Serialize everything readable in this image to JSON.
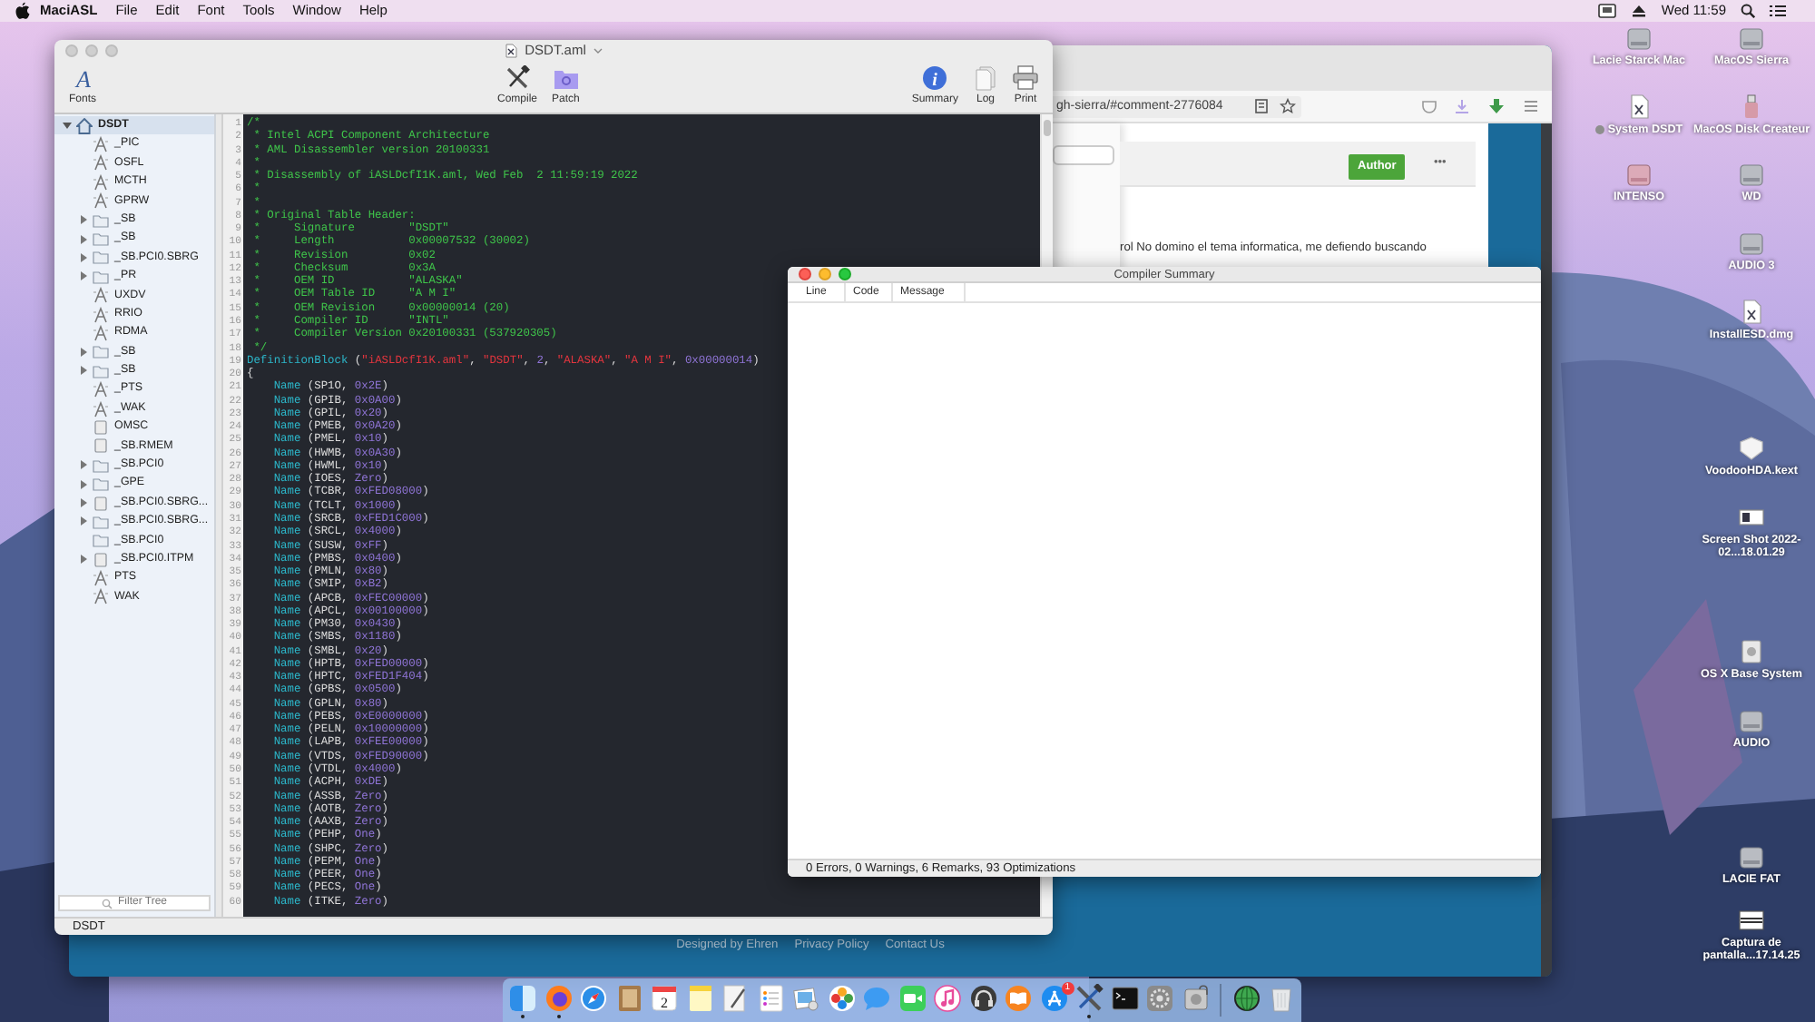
{
  "menubar": {
    "app": "MaciASL",
    "menus": [
      "File",
      "Edit",
      "Font",
      "Tools",
      "Window",
      "Help"
    ],
    "clock": "Wed 11:59"
  },
  "browser": {
    "url": "gh-sierra/#comment-2776084",
    "badge": "Author",
    "more": "•••",
    "text": "rol No domino el tema informatica, me defiendo buscando",
    "footer_links": [
      "Designed by Ehren",
      "Privacy Policy",
      "Contact Us"
    ]
  },
  "editor": {
    "title": "DSDT.aml",
    "toolbar": [
      {
        "kind": "fonts",
        "glyph": "A",
        "label": "Fonts"
      },
      {
        "kind": "compile",
        "label": "Compile"
      },
      {
        "kind": "patch",
        "label": "Patch"
      },
      {
        "kind": "summary",
        "glyph": "i",
        "label": "Summary"
      },
      {
        "kind": "log",
        "label": "Log"
      },
      {
        "kind": "print",
        "label": "Print"
      }
    ],
    "tree": {
      "label": "DSDT",
      "kind": "root",
      "expandable": true,
      "expanded": true,
      "selected": true,
      "children": [
        {
          "label": "_PIC",
          "kind": "method",
          "expandable": false,
          "expanded": false,
          "selected": false
        },
        {
          "label": "OSFL",
          "kind": "method",
          "expandable": false,
          "expanded": false,
          "selected": false
        },
        {
          "label": "MCTH",
          "kind": "method",
          "expandable": false,
          "expanded": false,
          "selected": false
        },
        {
          "label": "GPRW",
          "kind": "method",
          "expandable": false,
          "expanded": false,
          "selected": false
        },
        {
          "label": "_SB",
          "kind": "folder",
          "expandable": true,
          "expanded": false,
          "selected": false
        },
        {
          "label": "_SB",
          "kind": "folder",
          "expandable": true,
          "expanded": false,
          "selected": false
        },
        {
          "label": "_SB.PCI0.SBRG",
          "kind": "folder",
          "expandable": true,
          "expanded": false,
          "selected": false
        },
        {
          "label": "_PR",
          "kind": "folder",
          "expandable": true,
          "expanded": false,
          "selected": false
        },
        {
          "label": "UXDV",
          "kind": "method",
          "expandable": false,
          "expanded": false,
          "selected": false
        },
        {
          "label": "RRIO",
          "kind": "method",
          "expandable": false,
          "expanded": false,
          "selected": false
        },
        {
          "label": "RDMA",
          "kind": "method",
          "expandable": false,
          "expanded": false,
          "selected": false
        },
        {
          "label": "_SB",
          "kind": "folder",
          "expandable": true,
          "expanded": false,
          "selected": false
        },
        {
          "label": "_SB",
          "kind": "folder",
          "expandable": true,
          "expanded": false,
          "selected": false
        },
        {
          "label": "_PTS",
          "kind": "method",
          "expandable": false,
          "expanded": false,
          "selected": false
        },
        {
          "label": "_WAK",
          "kind": "method",
          "expandable": false,
          "expanded": false,
          "selected": false
        },
        {
          "label": "OMSC",
          "kind": "device",
          "expandable": false,
          "expanded": false,
          "selected": false
        },
        {
          "label": "_SB.RMEM",
          "kind": "device",
          "expandable": false,
          "expanded": false,
          "selected": false
        },
        {
          "label": "_SB.PCI0",
          "kind": "folder",
          "expandable": true,
          "expanded": false,
          "selected": false
        },
        {
          "label": "_GPE",
          "kind": "folder",
          "expandable": true,
          "expanded": false,
          "selected": false
        },
        {
          "label": "_SB.PCI0.SBRG...",
          "kind": "device",
          "expandable": true,
          "expanded": false,
          "selected": false
        },
        {
          "label": "_SB.PCI0.SBRG...",
          "kind": "folder",
          "expandable": true,
          "expanded": false,
          "selected": false
        },
        {
          "label": "_SB.PCI0",
          "kind": "folder",
          "expandable": false,
          "expanded": false,
          "selected": false
        },
        {
          "label": "_SB.PCI0.ITPM",
          "kind": "device",
          "expandable": true,
          "expanded": false,
          "selected": false
        },
        {
          "label": "PTS",
          "kind": "method",
          "expandable": false,
          "expanded": false,
          "selected": false
        },
        {
          "label": "WAK",
          "kind": "method",
          "expandable": false,
          "expanded": false,
          "selected": false
        }
      ]
    },
    "filter_placeholder": "Filter Tree",
    "code": [
      {
        "n": "1",
        "indented": false,
        "tokens": [
          {
            "kind": "comment",
            "text": "/*"
          }
        ]
      },
      {
        "n": "2",
        "indented": false,
        "tokens": [
          {
            "kind": "comment",
            "text": " * Intel ACPI Component Architecture"
          }
        ]
      },
      {
        "n": "3",
        "indented": false,
        "tokens": [
          {
            "kind": "comment",
            "text": " * AML Disassembler version 20100331"
          }
        ]
      },
      {
        "n": "4",
        "indented": false,
        "tokens": [
          {
            "kind": "comment",
            "text": " *"
          }
        ]
      },
      {
        "n": "5",
        "indented": false,
        "tokens": [
          {
            "kind": "comment",
            "text": " * Disassembly of iASLDcfI1K.aml, Wed Feb  2 11:59:19 2022"
          }
        ]
      },
      {
        "n": "6",
        "indented": false,
        "tokens": [
          {
            "kind": "comment",
            "text": " *"
          }
        ]
      },
      {
        "n": "7",
        "indented": false,
        "tokens": [
          {
            "kind": "comment",
            "text": " *"
          }
        ]
      },
      {
        "n": "8",
        "indented": false,
        "tokens": [
          {
            "kind": "comment",
            "text": " * Original Table Header:"
          }
        ]
      },
      {
        "n": "9",
        "indented": false,
        "tokens": [
          {
            "kind": "comment",
            "text": " *     Signature        \"DSDT\""
          }
        ]
      },
      {
        "n": "10",
        "indented": false,
        "tokens": [
          {
            "kind": "comment",
            "text": " *     Length           0x00007532 (30002)"
          }
        ]
      },
      {
        "n": "11",
        "indented": false,
        "tokens": [
          {
            "kind": "comment",
            "text": " *     Revision         0x02"
          }
        ]
      },
      {
        "n": "12",
        "indented": false,
        "tokens": [
          {
            "kind": "comment",
            "text": " *     Checksum         0x3A"
          }
        ]
      },
      {
        "n": "13",
        "indented": false,
        "tokens": [
          {
            "kind": "comment",
            "text": " *     OEM ID           \"ALASKA\""
          }
        ]
      },
      {
        "n": "14",
        "indented": false,
        "tokens": [
          {
            "kind": "comment",
            "text": " *     OEM Table ID     \"A M I\""
          }
        ]
      },
      {
        "n": "15",
        "indented": false,
        "tokens": [
          {
            "kind": "comment",
            "text": " *     OEM Revision     0x00000014 (20)"
          }
        ]
      },
      {
        "n": "16",
        "indented": false,
        "tokens": [
          {
            "kind": "comment",
            "text": " *     Compiler ID      \"INTL\""
          }
        ]
      },
      {
        "n": "17",
        "indented": false,
        "tokens": [
          {
            "kind": "comment",
            "text": " *     Compiler Version 0x20100331 (537920305)"
          }
        ]
      },
      {
        "n": "18",
        "indented": false,
        "tokens": [
          {
            "kind": "comment",
            "text": " */"
          }
        ]
      },
      {
        "n": "19",
        "indented": false,
        "tokens": [
          {
            "kind": "keyword",
            "text": "DefinitionBlock"
          },
          {
            "kind": "plain",
            "text": " ("
          },
          {
            "kind": "string",
            "text": "\"iASLDcfI1K.aml\""
          },
          {
            "kind": "plain",
            "text": ", "
          },
          {
            "kind": "string",
            "text": "\"DSDT\""
          },
          {
            "kind": "plain",
            "text": ", "
          },
          {
            "kind": "value",
            "text": "2"
          },
          {
            "kind": "plain",
            "text": ", "
          },
          {
            "kind": "string",
            "text": "\"ALASKA\""
          },
          {
            "kind": "plain",
            "text": ", "
          },
          {
            "kind": "string",
            "text": "\"A M I\""
          },
          {
            "kind": "plain",
            "text": ", "
          },
          {
            "kind": "value",
            "text": "0x00000014"
          },
          {
            "kind": "plain",
            "text": ")"
          }
        ]
      },
      {
        "n": "20",
        "indented": false,
        "tokens": [
          {
            "kind": "plain",
            "text": "{"
          }
        ]
      },
      {
        "n": "21",
        "indented": true,
        "tokens": [
          {
            "kind": "keyword",
            "text": "Name"
          },
          {
            "kind": "plain",
            "text": " (SP1O, "
          },
          {
            "kind": "value",
            "text": "0x2E"
          },
          {
            "kind": "plain",
            "text": ")"
          }
        ]
      },
      {
        "n": "22",
        "indented": true,
        "tokens": [
          {
            "kind": "keyword",
            "text": "Name"
          },
          {
            "kind": "plain",
            "text": " (GPIB, "
          },
          {
            "kind": "value",
            "text": "0x0A00"
          },
          {
            "kind": "plain",
            "text": ")"
          }
        ]
      },
      {
        "n": "23",
        "indented": true,
        "tokens": [
          {
            "kind": "keyword",
            "text": "Name"
          },
          {
            "kind": "plain",
            "text": " (GPIL, "
          },
          {
            "kind": "value",
            "text": "0x20"
          },
          {
            "kind": "plain",
            "text": ")"
          }
        ]
      },
      {
        "n": "24",
        "indented": true,
        "tokens": [
          {
            "kind": "keyword",
            "text": "Name"
          },
          {
            "kind": "plain",
            "text": " (PMEB, "
          },
          {
            "kind": "value",
            "text": "0x0A20"
          },
          {
            "kind": "plain",
            "text": ")"
          }
        ]
      },
      {
        "n": "25",
        "indented": true,
        "tokens": [
          {
            "kind": "keyword",
            "text": "Name"
          },
          {
            "kind": "plain",
            "text": " (PMEL, "
          },
          {
            "kind": "value",
            "text": "0x10"
          },
          {
            "kind": "plain",
            "text": ")"
          }
        ]
      },
      {
        "n": "26",
        "indented": true,
        "tokens": [
          {
            "kind": "keyword",
            "text": "Name"
          },
          {
            "kind": "plain",
            "text": " (HWMB, "
          },
          {
            "kind": "value",
            "text": "0x0A30"
          },
          {
            "kind": "plain",
            "text": ")"
          }
        ]
      },
      {
        "n": "27",
        "indented": true,
        "tokens": [
          {
            "kind": "keyword",
            "text": "Name"
          },
          {
            "kind": "plain",
            "text": " (HWML, "
          },
          {
            "kind": "value",
            "text": "0x10"
          },
          {
            "kind": "plain",
            "text": ")"
          }
        ]
      },
      {
        "n": "28",
        "indented": true,
        "tokens": [
          {
            "kind": "keyword",
            "text": "Name"
          },
          {
            "kind": "plain",
            "text": " (IOES, "
          },
          {
            "kind": "value",
            "text": "Zero"
          },
          {
            "kind": "plain",
            "text": ")"
          }
        ]
      },
      {
        "n": "29",
        "indented": true,
        "tokens": [
          {
            "kind": "keyword",
            "text": "Name"
          },
          {
            "kind": "plain",
            "text": " (TCBR, "
          },
          {
            "kind": "value",
            "text": "0xFED08000"
          },
          {
            "kind": "plain",
            "text": ")"
          }
        ]
      },
      {
        "n": "30",
        "indented": true,
        "tokens": [
          {
            "kind": "keyword",
            "text": "Name"
          },
          {
            "kind": "plain",
            "text": " (TCLT, "
          },
          {
            "kind": "value",
            "text": "0x1000"
          },
          {
            "kind": "plain",
            "text": ")"
          }
        ]
      },
      {
        "n": "31",
        "indented": true,
        "tokens": [
          {
            "kind": "keyword",
            "text": "Name"
          },
          {
            "kind": "plain",
            "text": " (SRCB, "
          },
          {
            "kind": "value",
            "text": "0xFED1C000"
          },
          {
            "kind": "plain",
            "text": ")"
          }
        ]
      },
      {
        "n": "32",
        "indented": true,
        "tokens": [
          {
            "kind": "keyword",
            "text": "Name"
          },
          {
            "kind": "plain",
            "text": " (SRCL, "
          },
          {
            "kind": "value",
            "text": "0x4000"
          },
          {
            "kind": "plain",
            "text": ")"
          }
        ]
      },
      {
        "n": "33",
        "indented": true,
        "tokens": [
          {
            "kind": "keyword",
            "text": "Name"
          },
          {
            "kind": "plain",
            "text": " (SUSW, "
          },
          {
            "kind": "value",
            "text": "0xFF"
          },
          {
            "kind": "plain",
            "text": ")"
          }
        ]
      },
      {
        "n": "34",
        "indented": true,
        "tokens": [
          {
            "kind": "keyword",
            "text": "Name"
          },
          {
            "kind": "plain",
            "text": " (PMBS, "
          },
          {
            "kind": "value",
            "text": "0x0400"
          },
          {
            "kind": "plain",
            "text": ")"
          }
        ]
      },
      {
        "n": "35",
        "indented": true,
        "tokens": [
          {
            "kind": "keyword",
            "text": "Name"
          },
          {
            "kind": "plain",
            "text": " (PMLN, "
          },
          {
            "kind": "value",
            "text": "0x80"
          },
          {
            "kind": "plain",
            "text": ")"
          }
        ]
      },
      {
        "n": "36",
        "indented": true,
        "tokens": [
          {
            "kind": "keyword",
            "text": "Name"
          },
          {
            "kind": "plain",
            "text": " (SMIP, "
          },
          {
            "kind": "value",
            "text": "0xB2"
          },
          {
            "kind": "plain",
            "text": ")"
          }
        ]
      },
      {
        "n": "37",
        "indented": true,
        "tokens": [
          {
            "kind": "keyword",
            "text": "Name"
          },
          {
            "kind": "plain",
            "text": " (APCB, "
          },
          {
            "kind": "value",
            "text": "0xFEC00000"
          },
          {
            "kind": "plain",
            "text": ")"
          }
        ]
      },
      {
        "n": "38",
        "indented": true,
        "tokens": [
          {
            "kind": "keyword",
            "text": "Name"
          },
          {
            "kind": "plain",
            "text": " (APCL, "
          },
          {
            "kind": "value",
            "text": "0x00100000"
          },
          {
            "kind": "plain",
            "text": ")"
          }
        ]
      },
      {
        "n": "39",
        "indented": true,
        "tokens": [
          {
            "kind": "keyword",
            "text": "Name"
          },
          {
            "kind": "plain",
            "text": " (PM30, "
          },
          {
            "kind": "value",
            "text": "0x0430"
          },
          {
            "kind": "plain",
            "text": ")"
          }
        ]
      },
      {
        "n": "40",
        "indented": true,
        "tokens": [
          {
            "kind": "keyword",
            "text": "Name"
          },
          {
            "kind": "plain",
            "text": " (SMBS, "
          },
          {
            "kind": "value",
            "text": "0x1180"
          },
          {
            "kind": "plain",
            "text": ")"
          }
        ]
      },
      {
        "n": "41",
        "indented": true,
        "tokens": [
          {
            "kind": "keyword",
            "text": "Name"
          },
          {
            "kind": "plain",
            "text": " (SMBL, "
          },
          {
            "kind": "value",
            "text": "0x20"
          },
          {
            "kind": "plain",
            "text": ")"
          }
        ]
      },
      {
        "n": "42",
        "indented": true,
        "tokens": [
          {
            "kind": "keyword",
            "text": "Name"
          },
          {
            "kind": "plain",
            "text": " (HPTB, "
          },
          {
            "kind": "value",
            "text": "0xFED00000"
          },
          {
            "kind": "plain",
            "text": ")"
          }
        ]
      },
      {
        "n": "43",
        "indented": true,
        "tokens": [
          {
            "kind": "keyword",
            "text": "Name"
          },
          {
            "kind": "plain",
            "text": " (HPTC, "
          },
          {
            "kind": "value",
            "text": "0xFED1F404"
          },
          {
            "kind": "plain",
            "text": ")"
          }
        ]
      },
      {
        "n": "44",
        "indented": true,
        "tokens": [
          {
            "kind": "keyword",
            "text": "Name"
          },
          {
            "kind": "plain",
            "text": " (GPBS, "
          },
          {
            "kind": "value",
            "text": "0x0500"
          },
          {
            "kind": "plain",
            "text": ")"
          }
        ]
      },
      {
        "n": "45",
        "indented": true,
        "tokens": [
          {
            "kind": "keyword",
            "text": "Name"
          },
          {
            "kind": "plain",
            "text": " (GPLN, "
          },
          {
            "kind": "value",
            "text": "0x80"
          },
          {
            "kind": "plain",
            "text": ")"
          }
        ]
      },
      {
        "n": "46",
        "indented": true,
        "tokens": [
          {
            "kind": "keyword",
            "text": "Name"
          },
          {
            "kind": "plain",
            "text": " (PEBS, "
          },
          {
            "kind": "value",
            "text": "0xE0000000"
          },
          {
            "kind": "plain",
            "text": ")"
          }
        ]
      },
      {
        "n": "47",
        "indented": true,
        "tokens": [
          {
            "kind": "keyword",
            "text": "Name"
          },
          {
            "kind": "plain",
            "text": " (PELN, "
          },
          {
            "kind": "value",
            "text": "0x10000000"
          },
          {
            "kind": "plain",
            "text": ")"
          }
        ]
      },
      {
        "n": "48",
        "indented": true,
        "tokens": [
          {
            "kind": "keyword",
            "text": "Name"
          },
          {
            "kind": "plain",
            "text": " (LAPB, "
          },
          {
            "kind": "value",
            "text": "0xFEE00000"
          },
          {
            "kind": "plain",
            "text": ")"
          }
        ]
      },
      {
        "n": "49",
        "indented": true,
        "tokens": [
          {
            "kind": "keyword",
            "text": "Name"
          },
          {
            "kind": "plain",
            "text": " (VTDS, "
          },
          {
            "kind": "value",
            "text": "0xFED90000"
          },
          {
            "kind": "plain",
            "text": ")"
          }
        ]
      },
      {
        "n": "50",
        "indented": true,
        "tokens": [
          {
            "kind": "keyword",
            "text": "Name"
          },
          {
            "kind": "plain",
            "text": " (VTDL, "
          },
          {
            "kind": "value",
            "text": "0x4000"
          },
          {
            "kind": "plain",
            "text": ")"
          }
        ]
      },
      {
        "n": "51",
        "indented": true,
        "tokens": [
          {
            "kind": "keyword",
            "text": "Name"
          },
          {
            "kind": "plain",
            "text": " (ACPH, "
          },
          {
            "kind": "value",
            "text": "0xDE"
          },
          {
            "kind": "plain",
            "text": ")"
          }
        ]
      },
      {
        "n": "52",
        "indented": true,
        "tokens": [
          {
            "kind": "keyword",
            "text": "Name"
          },
          {
            "kind": "plain",
            "text": " (ASSB, "
          },
          {
            "kind": "value",
            "text": "Zero"
          },
          {
            "kind": "plain",
            "text": ")"
          }
        ]
      },
      {
        "n": "53",
        "indented": true,
        "tokens": [
          {
            "kind": "keyword",
            "text": "Name"
          },
          {
            "kind": "plain",
            "text": " (AOTB, "
          },
          {
            "kind": "value",
            "text": "Zero"
          },
          {
            "kind": "plain",
            "text": ")"
          }
        ]
      },
      {
        "n": "54",
        "indented": true,
        "tokens": [
          {
            "kind": "keyword",
            "text": "Name"
          },
          {
            "kind": "plain",
            "text": " (AAXB, "
          },
          {
            "kind": "value",
            "text": "Zero"
          },
          {
            "kind": "plain",
            "text": ")"
          }
        ]
      },
      {
        "n": "55",
        "indented": true,
        "tokens": [
          {
            "kind": "keyword",
            "text": "Name"
          },
          {
            "kind": "plain",
            "text": " (PEHP, "
          },
          {
            "kind": "value",
            "text": "One"
          },
          {
            "kind": "plain",
            "text": ")"
          }
        ]
      },
      {
        "n": "56",
        "indented": true,
        "tokens": [
          {
            "kind": "keyword",
            "text": "Name"
          },
          {
            "kind": "plain",
            "text": " (SHPC, "
          },
          {
            "kind": "value",
            "text": "Zero"
          },
          {
            "kind": "plain",
            "text": ")"
          }
        ]
      },
      {
        "n": "57",
        "indented": true,
        "tokens": [
          {
            "kind": "keyword",
            "text": "Name"
          },
          {
            "kind": "plain",
            "text": " (PEPM, "
          },
          {
            "kind": "value",
            "text": "One"
          },
          {
            "kind": "plain",
            "text": ")"
          }
        ]
      },
      {
        "n": "58",
        "indented": true,
        "tokens": [
          {
            "kind": "keyword",
            "text": "Name"
          },
          {
            "kind": "plain",
            "text": " (PEER, "
          },
          {
            "kind": "value",
            "text": "One"
          },
          {
            "kind": "plain",
            "text": ")"
          }
        ]
      },
      {
        "n": "59",
        "indented": true,
        "tokens": [
          {
            "kind": "keyword",
            "text": "Name"
          },
          {
            "kind": "plain",
            "text": " (PECS, "
          },
          {
            "kind": "value",
            "text": "One"
          },
          {
            "kind": "plain",
            "text": ")"
          }
        ]
      },
      {
        "n": "60",
        "indented": true,
        "tokens": [
          {
            "kind": "keyword",
            "text": "Name"
          },
          {
            "kind": "plain",
            "text": " (ITKE, "
          },
          {
            "kind": "value",
            "text": "Zero"
          },
          {
            "kind": "plain",
            "text": ")"
          }
        ]
      }
    ],
    "status": "DSDT"
  },
  "compiler_summary": {
    "title": "Compiler Summary",
    "columns": [
      "Line",
      "Code",
      "Message"
    ],
    "status": "0 Errors, 0 Warnings, 6 Remarks, 93 Optimizations"
  },
  "desktop_icons": [
    {
      "kind": "drive",
      "label": "Lacie Starck Mac"
    },
    {
      "kind": "drive",
      "label": "MacOS Sierra"
    },
    {
      "kind": "file",
      "label": "System DSDT",
      "color": "#8e8e8e"
    },
    {
      "kind": "stick",
      "label": "MacOS Disk Createur"
    },
    {
      "kind": "flash",
      "label": "INTENSO"
    },
    {
      "kind": "drive",
      "label": "WD"
    },
    {
      "kind": "drive",
      "label": "AUDIO 3"
    },
    {
      "kind": "file",
      "label": "InstallESD.dmg"
    },
    {
      "kind": "package",
      "label": "VoodooHDA.kext"
    },
    {
      "kind": "screenshot",
      "label": "Screen Shot 2022-02...18.01.29"
    },
    {
      "kind": "disk",
      "label": "OS X Base System"
    },
    {
      "kind": "drive",
      "label": "AUDIO"
    },
    {
      "kind": "drive",
      "label": "LACIE FAT"
    },
    {
      "kind": "strip",
      "label": "Captura de pantalla...17.14.25"
    }
  ],
  "dock": [
    {
      "kind": "finder",
      "running": true
    },
    {
      "kind": "firefox",
      "running": true
    },
    {
      "kind": "safari",
      "running": false
    },
    {
      "kind": "contacts",
      "running": false
    },
    {
      "kind": "calendar",
      "running": false,
      "text": "2"
    },
    {
      "kind": "notes",
      "running": false
    },
    {
      "kind": "textedit",
      "running": false
    },
    {
      "kind": "reminders",
      "running": false
    },
    {
      "kind": "preview",
      "running": false
    },
    {
      "kind": "photos",
      "running": false
    },
    {
      "kind": "messages",
      "running": false
    },
    {
      "kind": "facetime",
      "running": false
    },
    {
      "kind": "itunes",
      "running": false
    },
    {
      "kind": "headphones",
      "running": false
    },
    {
      "kind": "books",
      "running": false
    },
    {
      "kind": "appstore",
      "running": false,
      "badge": "1"
    },
    {
      "kind": "maciasl",
      "running": true
    },
    {
      "kind": "terminal",
      "running": false
    },
    {
      "kind": "prefs",
      "running": false
    },
    {
      "kind": "diskutil",
      "running": false
    },
    {
      "kind": "separator"
    },
    {
      "kind": "globe",
      "running": false
    },
    {
      "kind": "trash",
      "running": false
    }
  ]
}
